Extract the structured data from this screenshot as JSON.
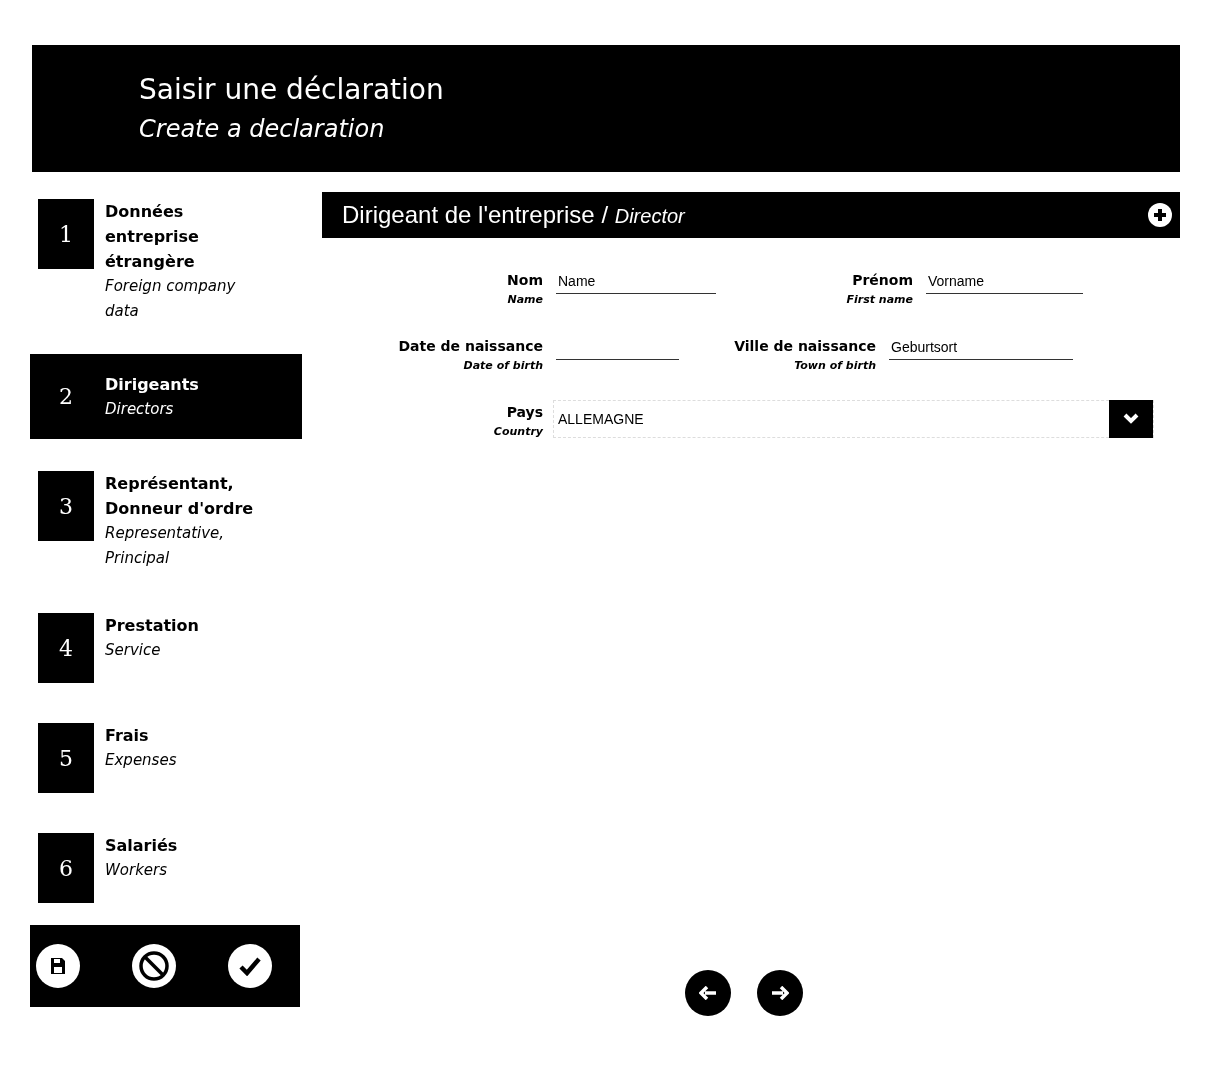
{
  "header": {
    "title": "Saisir une déclaration",
    "subtitle": "Create a declaration"
  },
  "steps": [
    {
      "number": "1",
      "title": "Données entreprise étrangère",
      "subtitle": "Foreign company data",
      "selected": false
    },
    {
      "number": "2",
      "title": "Dirigeants",
      "subtitle": "Directors",
      "selected": true
    },
    {
      "number": "3",
      "title": "Représentant, Donneur d'ordre",
      "subtitle": "Representative, Principal",
      "selected": false
    },
    {
      "number": "4",
      "title": "Prestation",
      "subtitle": "Service",
      "selected": false
    },
    {
      "number": "5",
      "title": "Frais",
      "subtitle": "Expenses",
      "selected": false
    },
    {
      "number": "6",
      "title": "Salariés",
      "subtitle": "Workers",
      "selected": false
    }
  ],
  "section": {
    "title": "Dirigeant de l'entreprise",
    "separator": "/",
    "subtitle": "Director"
  },
  "fields": [
    {
      "label": "Nom",
      "sublabel": "Name",
      "value": "Name"
    },
    {
      "label": "Prénom",
      "sublabel": "First name",
      "value": "Vorname"
    },
    {
      "label": "Date de naissance",
      "sublabel": "Date of birth"
    },
    {
      "label": "Ville de naissance",
      "sublabel": "Town of birth",
      "value": "Geburtsort"
    }
  ],
  "country": {
    "label": "Pays",
    "sublabel": "Country",
    "value": "ALLEMAGNE"
  }
}
